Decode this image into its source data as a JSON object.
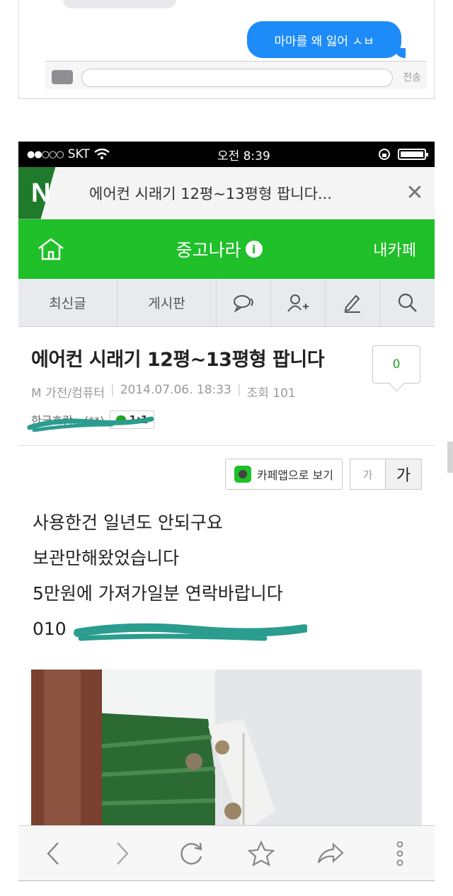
{
  "message_snippet": {
    "bubble_text": "마마를 왜 잃어 ㅅㅂ",
    "send_label": "전송"
  },
  "status_bar": {
    "carrier": "SKT",
    "time": "오전 8:39"
  },
  "browser": {
    "page_title": "에어컨 시래기 12평~13평형 팝니다...",
    "close_icon": "close-icon"
  },
  "cafe_header": {
    "cafe_name": "중고나라",
    "my_cafe": "내카페",
    "brand_color": "#1fc029"
  },
  "tabs": {
    "latest": "최신글",
    "board": "게시판"
  },
  "post": {
    "title": "에어컨 시래기 12평~13평형 팝니다",
    "comment_count": "0",
    "category": "M 가전/컴퓨터",
    "date": "2014.07.06. 18:33",
    "views": "조회 101",
    "author": "한국호랑…(**)",
    "chat_badge": "1:1",
    "view_in_app": "카페앱으로 보기",
    "font_small": "가",
    "font_large": "가",
    "body_lines": [
      "사용한건 일년도 안되구요",
      "보관만해왔었습니다",
      "5만원에 가져가일분 연락바랍니다"
    ],
    "phone_prefix": "010"
  }
}
